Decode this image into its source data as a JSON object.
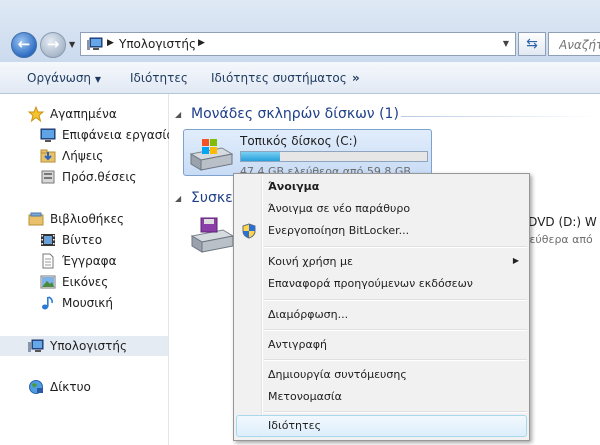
{
  "address": {
    "crumb": "Υπολογιστής",
    "search_placeholder": "Αναζήτηση"
  },
  "toolbar": {
    "organize": "Οργάνωση",
    "properties": "Ιδιότητες",
    "system_properties": "Ιδιότητες συστήματος",
    "more": "»"
  },
  "nav": {
    "favorites": "Αγαπημένα",
    "desktop": "Επιφάνεια εργασίας",
    "downloads": "Λήψεις",
    "recent": "Πρόσ.θέσεις",
    "libraries": "Βιβλιοθήκες",
    "videos": "Βίντεο",
    "documents": "Έγγραφα",
    "pictures": "Εικόνες",
    "music": "Μουσική",
    "computer": "Υπολογιστής",
    "network": "Δίκτυο"
  },
  "content": {
    "hdd_header": "Μονάδες σκληρών δίσκων (1)",
    "removable_header": "Συσκευ",
    "drive_name": "Τοπικός δίσκος (C:)",
    "drive_free": "47,4 GB ελεύθερα από 59,8 GB",
    "drive_used_fraction": 0.207,
    "dvd_name": "a DVD (D:) W",
    "dvd_free": "ελεύθερα από"
  },
  "menu": {
    "open": "Άνοιγμα",
    "open_new_window": "Άνοιγμα σε νέο παράθυρο",
    "bitlocker": "Ενεργοποίηση BitLocker...",
    "share_with": "Κοινή χρήση με",
    "restore_versions": "Επαναφορά προηγούμενων εκδόσεων",
    "format": "Διαμόρφωση...",
    "copy": "Αντιγραφή",
    "create_shortcut": "Δημιουργία συντόμευσης",
    "rename": "Μετονομασία",
    "properties": "Ιδιότητες"
  },
  "icons": {
    "back": "back-arrow-icon",
    "forward": "forward-arrow-icon",
    "refresh": "refresh-icon",
    "star": "star-icon",
    "shield": "uac-shield-icon"
  }
}
